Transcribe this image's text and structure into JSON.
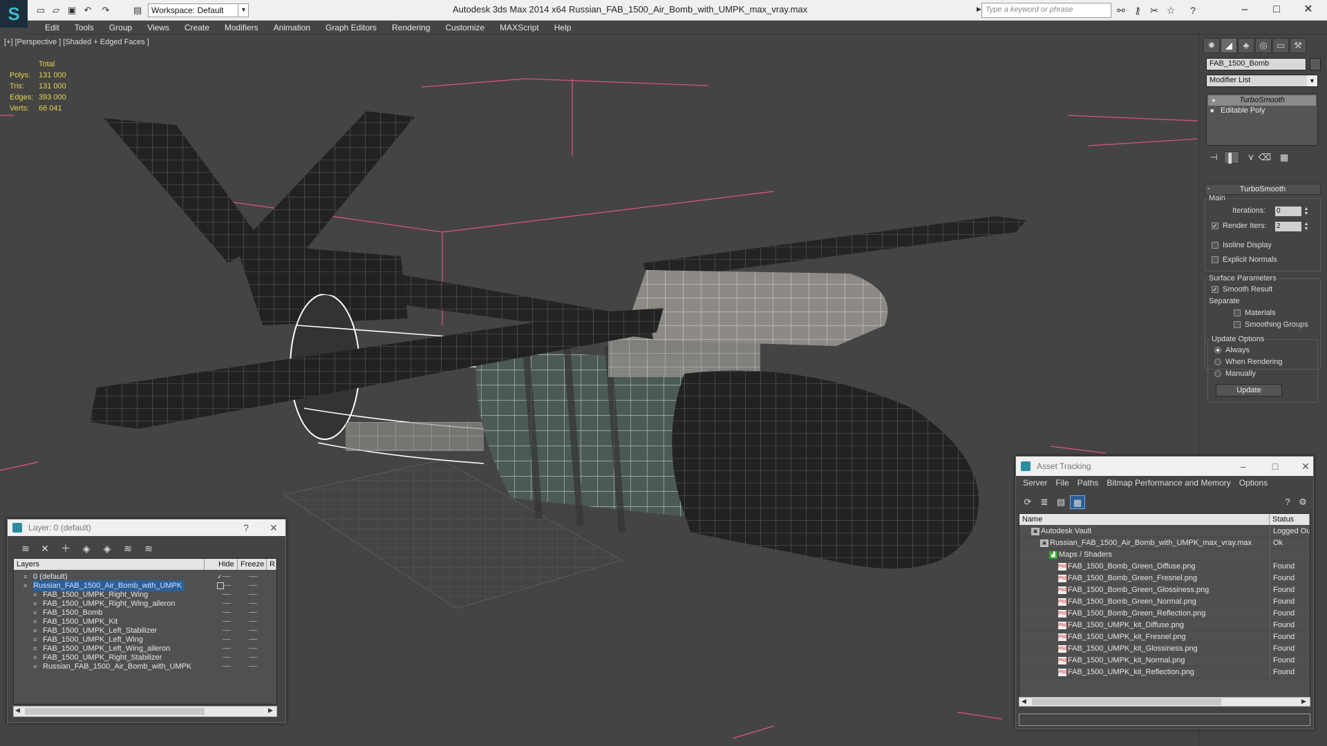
{
  "titlebar": {
    "app_title": "Autodesk 3ds Max  2014 x64",
    "file_name": "Russian_FAB_1500_Air_Bomb_with_UMPK_max_vray.max",
    "workspace": "Workspace: Default",
    "search_placeholder": "Type a keyword or phrase"
  },
  "menu": [
    "Edit",
    "Tools",
    "Group",
    "Views",
    "Create",
    "Modifiers",
    "Animation",
    "Graph Editors",
    "Rendering",
    "Customize",
    "MAXScript",
    "Help"
  ],
  "viewport": {
    "label": "[+] [Perspective ] [Shaded + Edged Faces ]",
    "stats_header": "Total",
    "stats": [
      {
        "k": "Polys:",
        "v": "131 000"
      },
      {
        "k": "Tris:",
        "v": "131 000"
      },
      {
        "k": "Edges:",
        "v": "393 000"
      },
      {
        "k": "Verts:",
        "v": "66 041"
      }
    ]
  },
  "command_panel": {
    "object_name": "FAB_1500_Bomb",
    "modifier_list": "Modifier List",
    "stack": [
      "TurboSmooth",
      "Editable Poly"
    ],
    "rollout": "TurboSmooth",
    "main_label": "Main",
    "iterations_label": "Iterations:",
    "iterations": "0",
    "render_iters_label": "Render Iters:",
    "render_iters": "2",
    "isoline": "Isoline Display",
    "explicit": "Explicit Normals",
    "surface_label": "Surface Parameters",
    "smooth_result": "Smooth Result",
    "separate_label": "Separate",
    "materials": "Materials",
    "smoothing_groups": "Smoothing Groups",
    "update_label": "Update Options",
    "always": "Always",
    "when_rendering": "When Rendering",
    "manually": "Manually",
    "update_btn": "Update"
  },
  "layer_window": {
    "title": "Layer: 0 (default)",
    "help": "?",
    "col_layers": "Layers",
    "col_hide": "Hide",
    "col_freeze": "Freeze",
    "col_r": "R",
    "rows": [
      {
        "name": "0 (default)",
        "indent": 1,
        "selected": false
      },
      {
        "name": "Russian_FAB_1500_Air_Bomb_with_UMPK",
        "indent": 1,
        "selected": true
      },
      {
        "name": "FAB_1500_UMPK_Right_Wing",
        "indent": 2,
        "selected": false
      },
      {
        "name": "FAB_1500_UMPK_Right_Wing_aileron",
        "indent": 2,
        "selected": false
      },
      {
        "name": "FAB_1500_Bomb",
        "indent": 2,
        "selected": false
      },
      {
        "name": "FAB_1500_UMPK_Kit",
        "indent": 2,
        "selected": false
      },
      {
        "name": "FAB_1500_UMPK_Left_Stabilizer",
        "indent": 2,
        "selected": false
      },
      {
        "name": "FAB_1500_UMPK_Left_Wing",
        "indent": 2,
        "selected": false
      },
      {
        "name": "FAB_1500_UMPK_Left_Wing_aileron",
        "indent": 2,
        "selected": false
      },
      {
        "name": "FAB_1500_UMPK_Right_Stabilizer",
        "indent": 2,
        "selected": false
      },
      {
        "name": "Russian_FAB_1500_Air_Bomb_with_UMPK",
        "indent": 2,
        "selected": false
      }
    ]
  },
  "asset_tracking": {
    "title": "Asset Tracking",
    "menu": [
      "Server",
      "File",
      "Paths",
      "Bitmap Performance and Memory",
      "Options"
    ],
    "col_name": "Name",
    "col_status": "Status",
    "rows": [
      {
        "name": "Autodesk Vault",
        "status": "Logged Out",
        "indent": 1,
        "icon": "vault-icon"
      },
      {
        "name": "Russian_FAB_1500_Air_Bomb_with_UMPK_max_vray.max",
        "status": "Ok",
        "indent": 2,
        "icon": "max-file-icon"
      },
      {
        "name": "Maps / Shaders",
        "status": "",
        "indent": 3,
        "icon": "maps-icon"
      },
      {
        "name": "FAB_1500_Bomb_Green_Diffuse.png",
        "status": "Found",
        "indent": 4,
        "icon": "png-icon"
      },
      {
        "name": "FAB_1500_Bomb_Green_Fresnel.png",
        "status": "Found",
        "indent": 4,
        "icon": "png-icon"
      },
      {
        "name": "FAB_1500_Bomb_Green_Glossiness.png",
        "status": "Found",
        "indent": 4,
        "icon": "png-icon"
      },
      {
        "name": "FAB_1500_Bomb_Green_Normal.png",
        "status": "Found",
        "indent": 4,
        "icon": "png-icon"
      },
      {
        "name": "FAB_1500_Bomb_Green_Reflection.png",
        "status": "Found",
        "indent": 4,
        "icon": "png-icon"
      },
      {
        "name": "FAB_1500_UMPK_kit_Diffuse.png",
        "status": "Found",
        "indent": 4,
        "icon": "png-icon"
      },
      {
        "name": "FAB_1500_UMPK_kit_Fresnel.png",
        "status": "Found",
        "indent": 4,
        "icon": "png-icon"
      },
      {
        "name": "FAB_1500_UMPK_kit_Glossiness.png",
        "status": "Found",
        "indent": 4,
        "icon": "png-icon"
      },
      {
        "name": "FAB_1500_UMPK_kit_Normal.png",
        "status": "Found",
        "indent": 4,
        "icon": "png-icon"
      },
      {
        "name": "FAB_1500_UMPK_kit_Reflection.png",
        "status": "Found",
        "indent": 4,
        "icon": "png-icon"
      }
    ]
  },
  "colors": {
    "viewport_bg": "#444444",
    "stats": "#e6d24f",
    "selection": "#2d5f96",
    "bbox": "#e0557a"
  }
}
